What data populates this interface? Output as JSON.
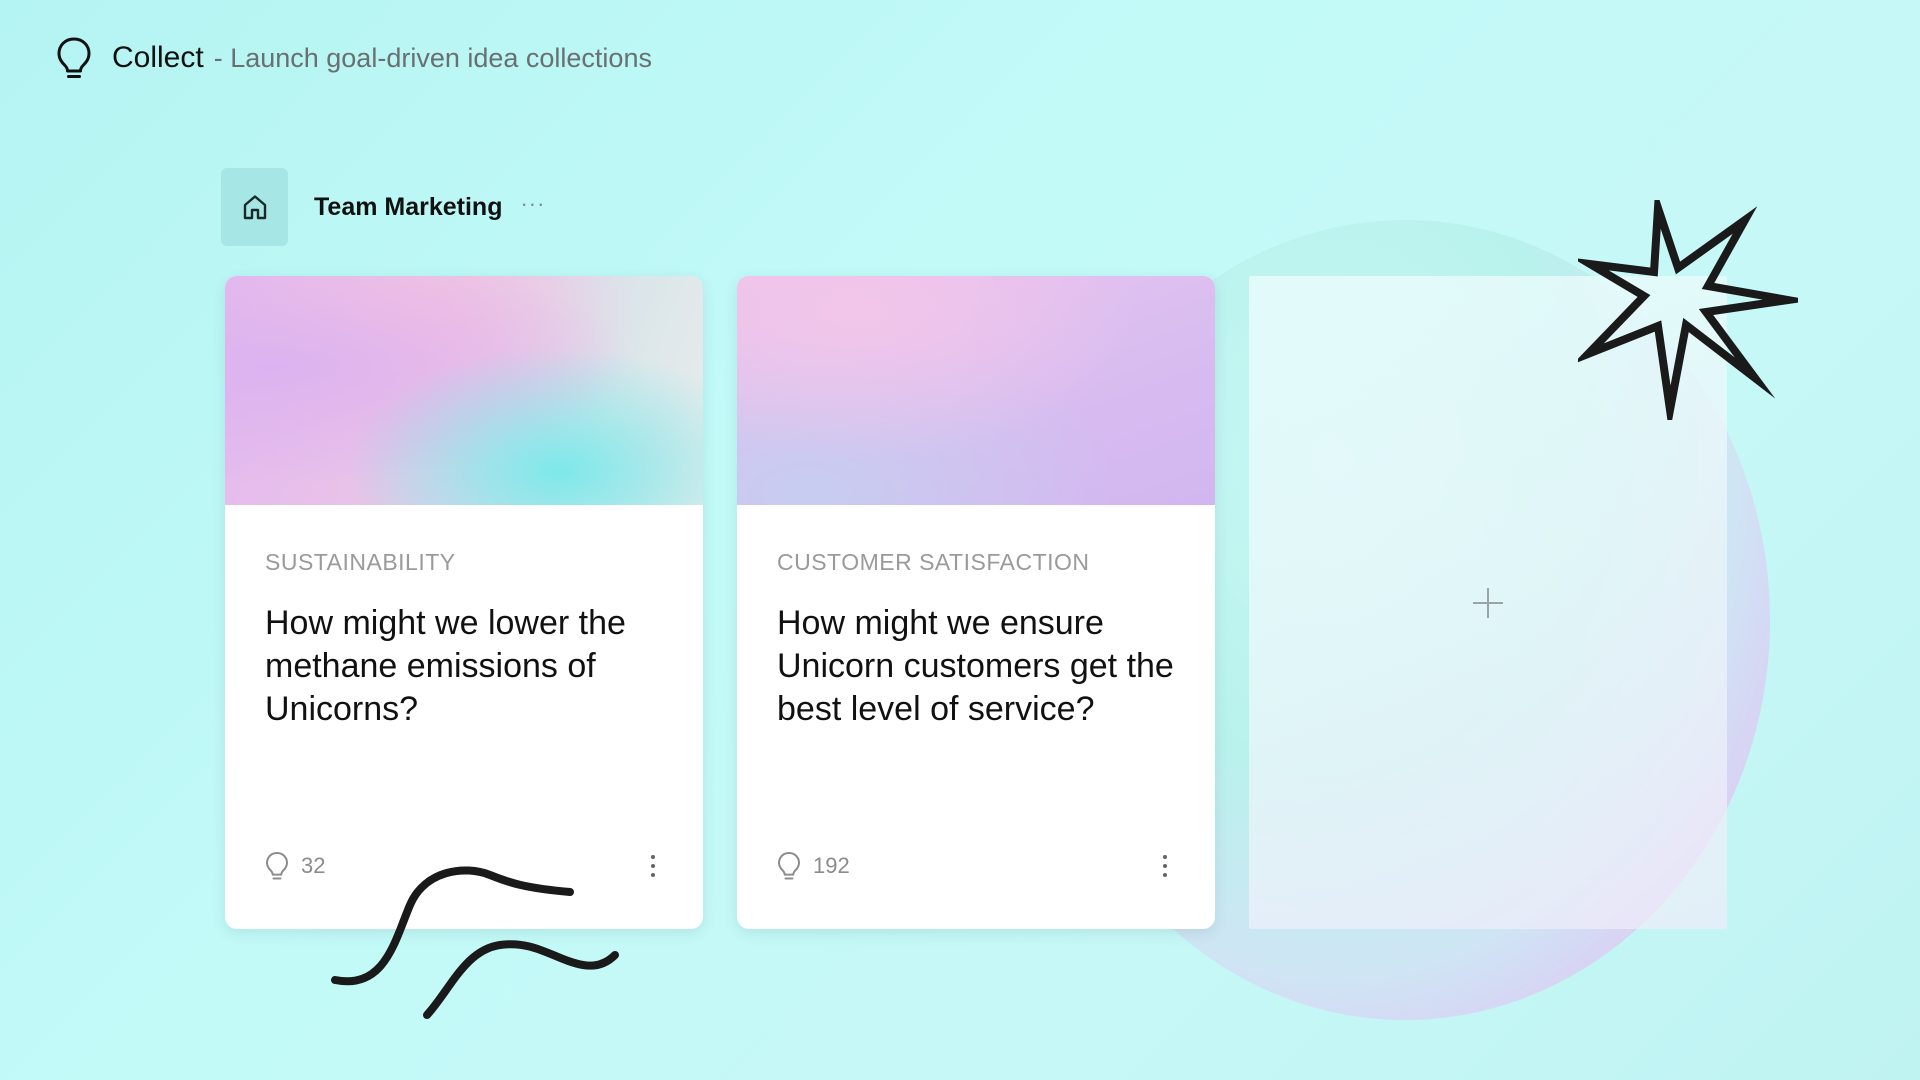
{
  "app": {
    "title": "Collect",
    "subtitle": "- Launch goal-driven idea collections",
    "icon": "lightbulb-icon"
  },
  "workspace": {
    "name": "Team Marketing",
    "more": "···",
    "home_icon": "home-icon"
  },
  "collections": [
    {
      "category": "SUSTAINABILITY",
      "question": "How might we lower the methane emissions of Unicorns?",
      "idea_count": "32"
    },
    {
      "category": "CUSTOMER SATISFACTION",
      "question": "How might we ensure Unicorn customers get the best level of service?",
      "idea_count": "192"
    }
  ],
  "add_collection": {
    "icon": "plus-icon"
  },
  "colors": {
    "background": "#bff7f5",
    "home_button": "#a6e7e5",
    "card": "#ffffff",
    "category_text": "#9a9a9a",
    "ink": "#111111"
  }
}
